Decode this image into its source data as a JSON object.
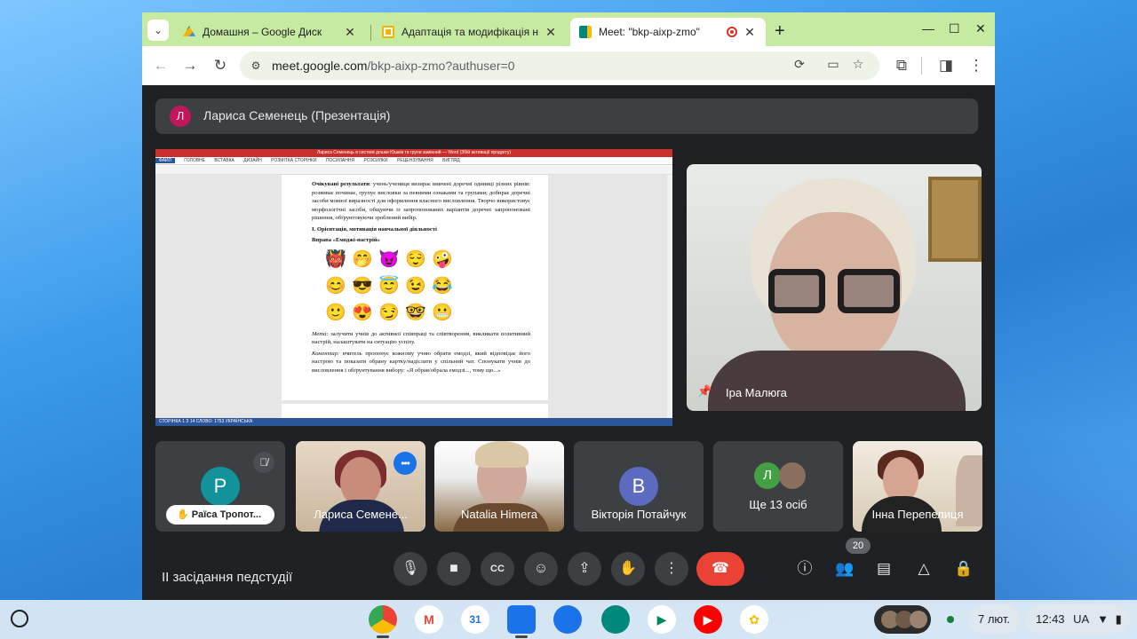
{
  "browser": {
    "tabs": [
      {
        "title": "Домашня – Google Диск",
        "favicon": "google-drive-icon",
        "color": "#1a73e8"
      },
      {
        "title": "Адаптація та модифікація на",
        "favicon": "google-slides-icon",
        "color": "#f4b400"
      },
      {
        "title": "Meet: \"bkp-aixp-zmo\"",
        "favicon": "google-meet-icon",
        "color": "#00897b"
      }
    ],
    "new_tab": "+",
    "window_controls": {
      "minimize": "—",
      "maximize": "☐",
      "close": "✕"
    },
    "url_host": "meet.google.com",
    "url_path": "/bkp-aixp-zmo?authuser=0"
  },
  "meet": {
    "presenter_initial": "Л",
    "presenter_label": "Лариса Семенець (Презентація)",
    "main_speaker_name": "Іра Малюга",
    "meeting_title": "ІІ засідання педстудії",
    "participant_count": "20",
    "tiles": [
      {
        "name": "Раїса Тропот...",
        "initial": "Р",
        "color": "#12939a"
      },
      {
        "name": "Лариса Семене..."
      },
      {
        "name": "Natalia Himera"
      },
      {
        "name": "Вікторія Потайчук",
        "initial": "В",
        "color": "#5c6bc0"
      },
      {
        "name": "Ще 13 осіб",
        "initial": "Л",
        "color": "#43a047"
      },
      {
        "name": "Інна Перепелиця"
      }
    ],
    "controls": [
      "mic-icon",
      "camera-icon",
      "captions-icon",
      "emoji-icon",
      "present-icon",
      "raise-hand-icon",
      "more-icon",
      "end-call-icon"
    ],
    "right_controls": [
      "info-icon",
      "people-icon",
      "chat-icon",
      "activities-icon",
      "host-controls-icon"
    ]
  },
  "doc": {
    "window_title": "Лариса Семенець в системі дошки Юшків та групи замінний — Word (Збій активації продукту)",
    "menu": [
      "ФАЙЛ",
      "ГОЛОВНЕ",
      "ВСТАВКА",
      "ДИЗАЙН",
      "РОЗМІТКА СТОРІНКИ",
      "ПОСИЛАННЯ",
      "РОЗСИЛКИ",
      "РЕЦЕНЗУВАННЯ",
      "ВИГЛЯД"
    ],
    "para1_label": "Очікувані результати",
    "para1": ": учень/учениця визирає вивчені доречні одиниці різних рівнів: розвиває починає, групує висловки за певними ознаками та групами; добирає доречні засоби мовної виразності для оформлення власного висловлення. Творчо використовує морфологічні засоби, общуючи із запропонованих варіантів доречні запропоновані рішення, обґрунтовуючи зроблений вибір.",
    "heading": "І. Орієнтація, мотивація навчальної діяльності",
    "exercise": "Вправа «Емоджі-настрій»",
    "emojis": [
      "👹",
      "🤭",
      "😈",
      "😌",
      "🤪",
      "😊",
      "😎",
      "😇",
      "😉",
      "😂",
      "🙂",
      "😍",
      "😏",
      "🤓",
      "😬"
    ],
    "para2_label": "Мета:",
    "para2": " залучити учнів до активної співпраці та співтворення, викликати позитивний настрій, налаштувати на ситуацію успіху.",
    "para3_label": "Коментар:",
    "para3": " вчитель пропонує кожному учню обрати емодзі, який відповідає його настрою та показати обрану картку/надіслати у спільний чат. Спонукати учнів до висловлення і обґрунтування вибору: «Я обрав/обрала емодзі..., тому що...»",
    "status": "СТОРІНКА 1 З 14    СЛОВО: 1753    УКРАЇНСЬКА"
  },
  "shelf": {
    "apps": [
      {
        "name": "chrome-icon",
        "color": "#34a853",
        "glyph": ""
      },
      {
        "name": "gmail-icon",
        "color": "#ea4335",
        "glyph": "M"
      },
      {
        "name": "calendar-icon",
        "color": "#1a73e8",
        "glyph": "31"
      },
      {
        "name": "files-icon",
        "color": "#1a73e8",
        "glyph": ""
      },
      {
        "name": "messages-icon",
        "color": "#1a73e8",
        "glyph": ""
      },
      {
        "name": "meet-icon",
        "color": "#00897b",
        "glyph": ""
      },
      {
        "name": "play-store-icon",
        "color": "#01875f",
        "glyph": "▶"
      },
      {
        "name": "youtube-icon",
        "color": "#ff0000",
        "glyph": "▶"
      },
      {
        "name": "photos-icon",
        "color": "#fbbc04",
        "glyph": "✿"
      }
    ],
    "date": "7 лют.",
    "time": "12:43",
    "lang": "UA"
  }
}
